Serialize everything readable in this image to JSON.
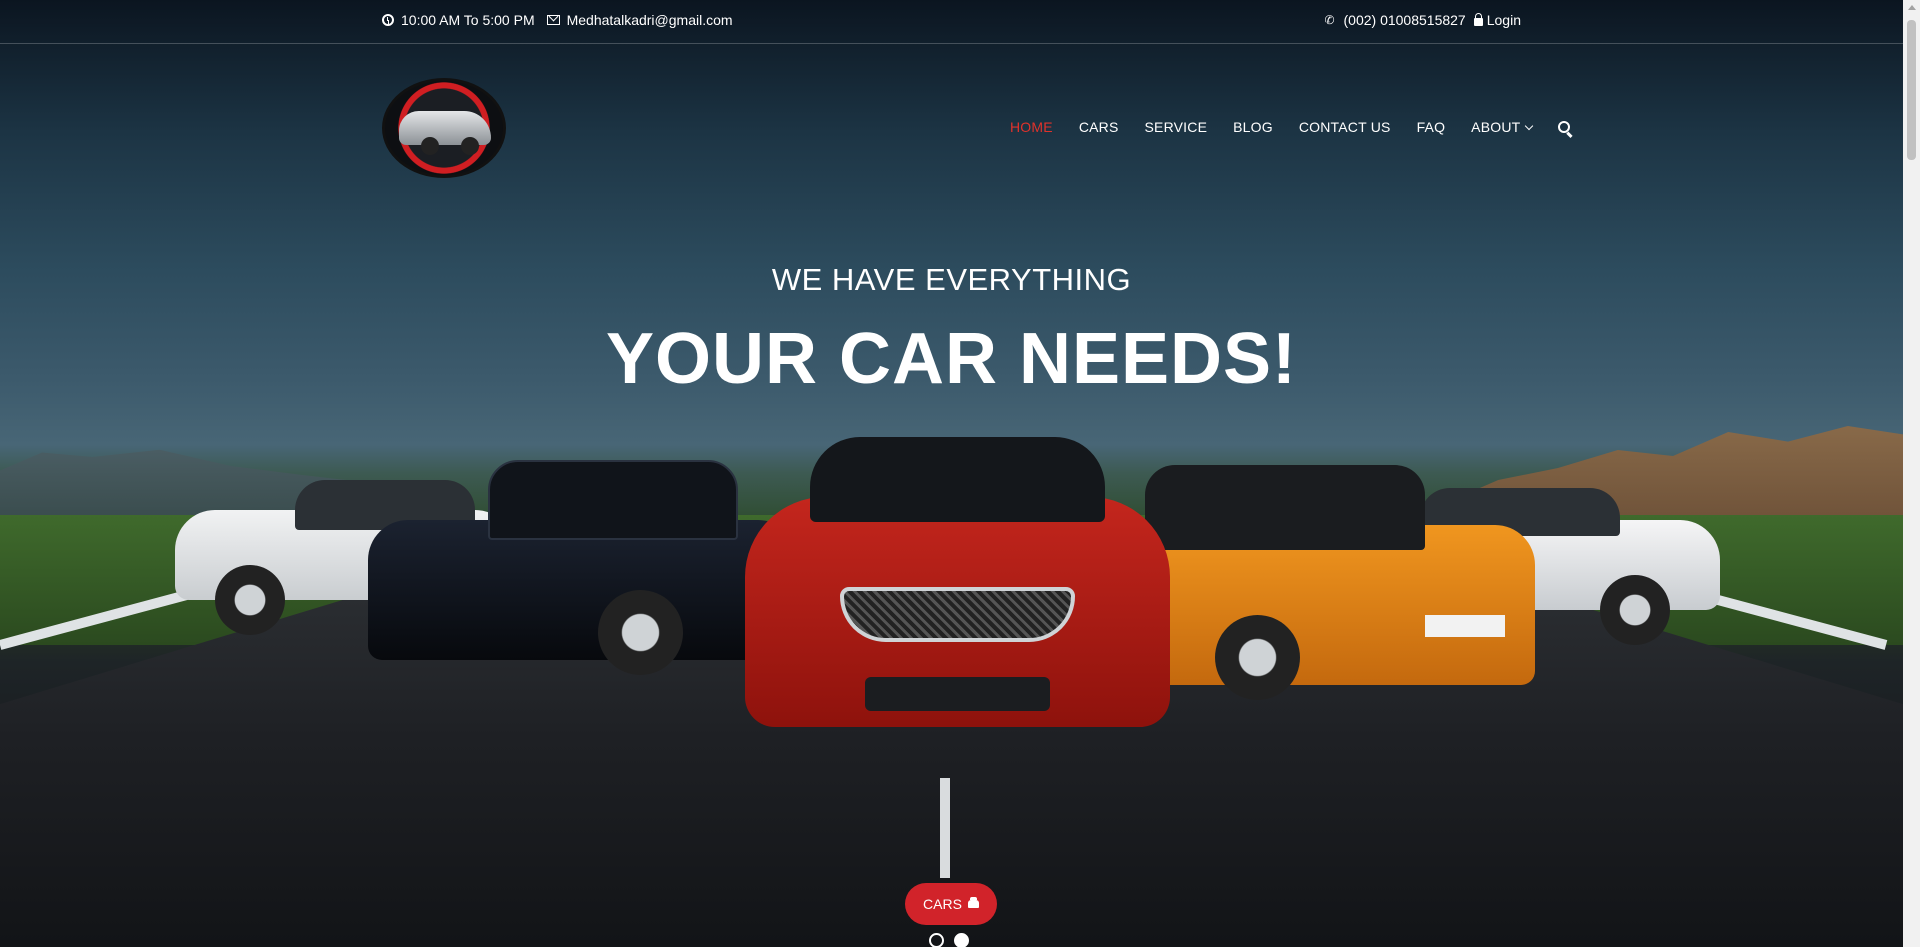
{
  "topbar": {
    "hours": "10:00 AM To 5:00 PM",
    "email": "Medhatalkadri@gmail.com",
    "phone": "(002) 01008515827",
    "login": "Login"
  },
  "nav": {
    "items": [
      {
        "label": "HOME",
        "active": true
      },
      {
        "label": "CARS"
      },
      {
        "label": "SERVICE"
      },
      {
        "label": "BLOG"
      },
      {
        "label": "CONTACT US"
      },
      {
        "label": "FAQ"
      },
      {
        "label": "ABOUT"
      }
    ],
    "active_color": "#e0322b"
  },
  "hero": {
    "subtitle": "WE HAVE EVERYTHING",
    "title": "YOUR CAR NEEDS!"
  },
  "cta": {
    "label": "CARS",
    "icon": "car-icon",
    "color": "#d1232a"
  },
  "slider": {
    "dots": 2,
    "active_index": 1
  },
  "icons": {
    "hours": "clock-icon",
    "email": "envelope-icon",
    "phone": "phone-icon",
    "login": "lock-icon",
    "search": "search-icon"
  }
}
